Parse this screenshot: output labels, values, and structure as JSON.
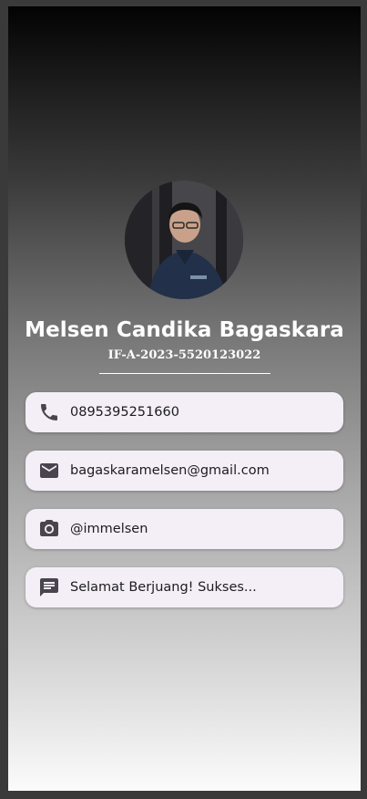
{
  "profile": {
    "name": "Melsen Candika Bagaskara",
    "nim": "IF-A-2023-5520123022"
  },
  "contacts": [
    {
      "icon": "phone-icon",
      "text": "0895395251660"
    },
    {
      "icon": "email-icon",
      "text": "bagaskaramelsen@gmail.com"
    },
    {
      "icon": "camera-icon",
      "text": "@immelsen"
    },
    {
      "icon": "message-icon",
      "text": "Selamat Berjuang! Sukses..."
    }
  ],
  "colors": {
    "card_background": "#f4eff7",
    "icon_color": "#49454f",
    "text_color": "#1c1b1f",
    "name_color": "#ffffff"
  }
}
